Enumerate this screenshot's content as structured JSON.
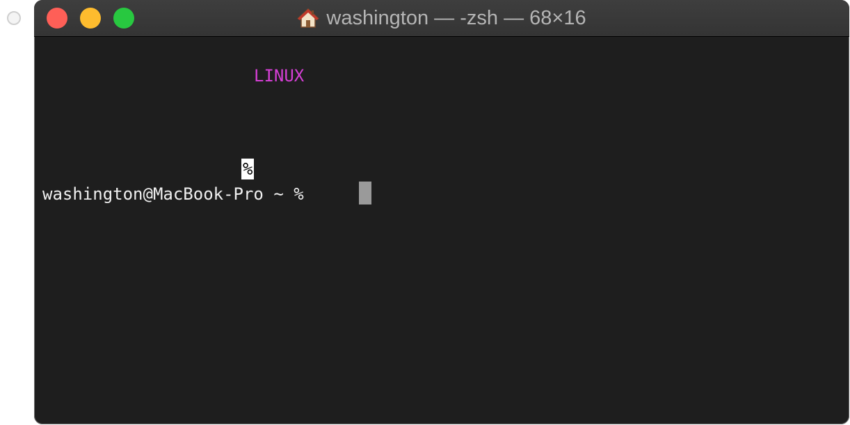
{
  "window": {
    "title": "washington — -zsh — 68×16"
  },
  "terminal": {
    "banner_text": "LINUX",
    "partial_line_marker": "%",
    "prompt_text": "washington@MacBook-Pro ~ %"
  },
  "colors": {
    "banner": "#d63fd6",
    "background": "#1e1e1e",
    "text": "#f0f0f0",
    "close": "#fe5f57",
    "minimize": "#febc2e",
    "maximize": "#28c840"
  }
}
